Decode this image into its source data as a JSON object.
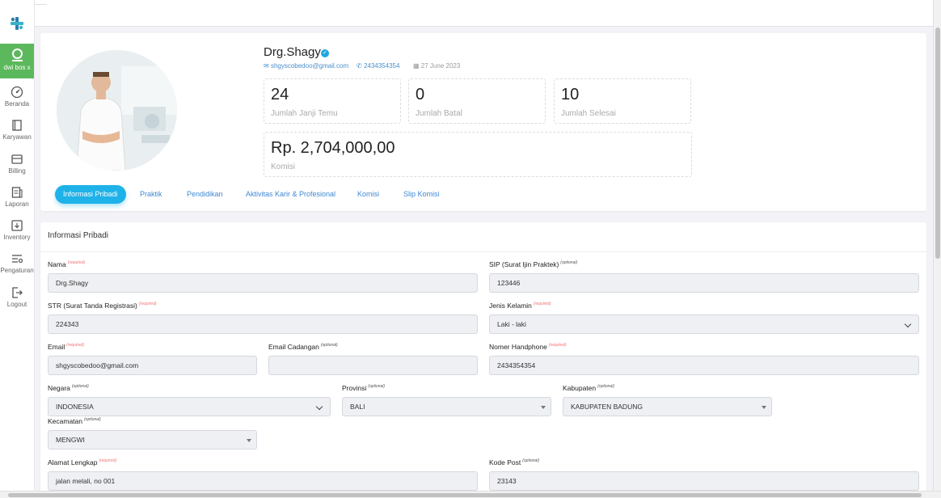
{
  "sidebar": {
    "user_label": "dwi bos x",
    "items": [
      {
        "label": "Beranda",
        "icon": "dashboard-icon"
      },
      {
        "label": "Karyawan",
        "icon": "book-icon"
      },
      {
        "label": "Billing",
        "icon": "wallet-icon"
      },
      {
        "label": "Laporan",
        "icon": "report-icon"
      },
      {
        "label": "Inventory",
        "icon": "inventory-icon"
      },
      {
        "label": "Pengaturan",
        "icon": "settings-icon"
      },
      {
        "label": "Logout",
        "icon": "logout-icon"
      }
    ]
  },
  "profile": {
    "name": "Drg.Shagy",
    "email": "shgyscobedoo@gmail.com",
    "phone": "2434354354",
    "date": "27 June 2023",
    "stats": [
      {
        "value": "24",
        "label": "Jumlah Janji Temu"
      },
      {
        "value": "0",
        "label": "Jumlah Batal"
      },
      {
        "value": "10",
        "label": "Jumlah Selesai"
      }
    ],
    "commission": {
      "value": "Rp. 2,704,000,00",
      "label": "Komisi"
    }
  },
  "tabs": [
    "Informasi Pribadi",
    "Praktik",
    "Pendidikan",
    "Aktivitas Karir & Profesional",
    "Komisi",
    "Slip Komisi"
  ],
  "form": {
    "title": "Informasi Pribadi",
    "required_tag": "(required)",
    "optional_tag": "(optional)",
    "nama": {
      "label": "Nama",
      "value": "Drg.Shagy"
    },
    "sip": {
      "label": "SIP (Surat Ijin Praktek)",
      "value": "123446"
    },
    "str": {
      "label": "STR (Surat Tanda Registrasi)",
      "value": "224343"
    },
    "jenis_kelamin": {
      "label": "Jenis Kelamin",
      "value": "Laki - laki"
    },
    "email": {
      "label": "Email",
      "value": "shgyscobedoo@gmail.com"
    },
    "email_cadangan": {
      "label": "Email Cadangan",
      "value": ""
    },
    "nomer_handphone": {
      "label": "Nomer Handphone",
      "value": "2434354354"
    },
    "negara": {
      "label": "Negara",
      "value": "INDONESIA"
    },
    "provinsi": {
      "label": "Provinsi",
      "value": "BALI"
    },
    "kabupaten": {
      "label": "Kabupaten",
      "value": "KABUPATEN BADUNG"
    },
    "kecamatan": {
      "label": "Kecamatan",
      "value": "MENGWI"
    },
    "alamat": {
      "label": "Alamat Lengkap",
      "value": "jalan melali, no 001"
    },
    "kode_post": {
      "label": "Kode Post",
      "value": "23143"
    }
  },
  "colors": {
    "accent": "#1eb2e8",
    "user_box": "#5cb85c",
    "link": "#3f89d3",
    "required": "#f37171"
  }
}
